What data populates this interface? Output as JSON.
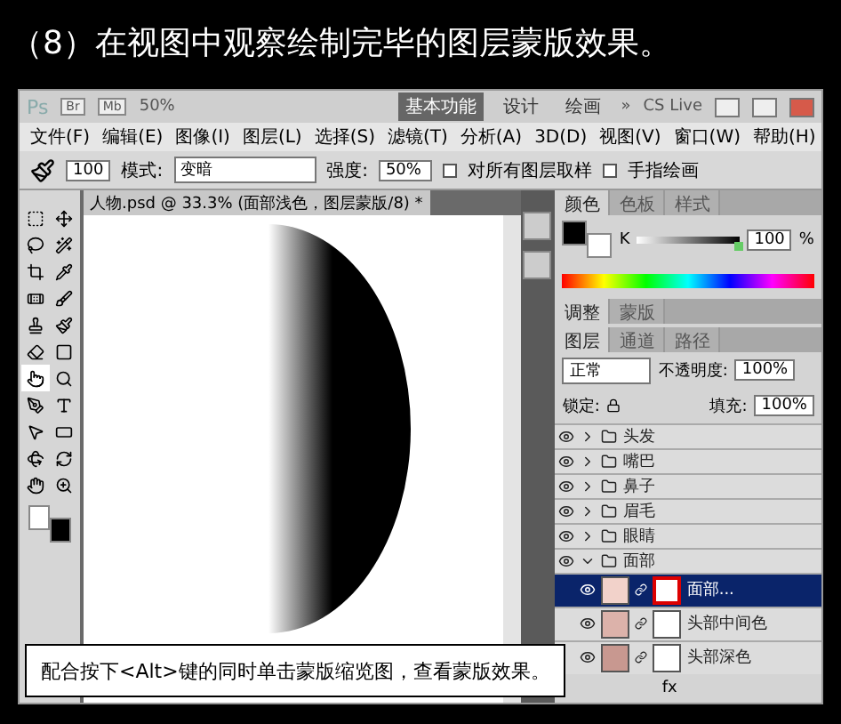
{
  "heading": "（8）在视图中观察绘制完毕的图层蒙版效果。",
  "app_bar": {
    "logo": "Ps",
    "bridge": "Br",
    "mini_bridge": "Mb",
    "zoom": "50%",
    "workspaces": [
      {
        "label": "基本功能",
        "selected": true
      },
      {
        "label": "设计",
        "selected": false
      },
      {
        "label": "绘画",
        "selected": false
      }
    ],
    "more": "»",
    "cs_live": "CS Live"
  },
  "menu": [
    "文件(F)",
    "编辑(E)",
    "图像(I)",
    "图层(L)",
    "选择(S)",
    "滤镜(T)",
    "分析(A)",
    "3D(D)",
    "视图(V)",
    "窗口(W)",
    "帮助(H)"
  ],
  "options": {
    "brush_size": "100",
    "mode_label": "模式:",
    "mode": "变暗",
    "strength_label": "强度:",
    "strength": "50%",
    "checks": [
      {
        "label": "对所有图层取样",
        "checked": false
      },
      {
        "label": "手指绘画",
        "checked": false
      }
    ]
  },
  "tools": [
    {
      "selected": false
    },
    {
      "selected": false
    },
    {
      "selected": false
    },
    {
      "selected": false
    },
    {
      "selected": false
    },
    {
      "selected": false
    },
    {
      "selected": false
    },
    {
      "selected": false
    },
    {
      "selected": false
    },
    {
      "selected": false
    },
    {
      "selected": false
    },
    {
      "selected": false
    },
    {
      "selected": true
    },
    {
      "selected": false
    },
    {
      "selected": false
    },
    {
      "selected": false
    },
    {
      "selected": false
    },
    {
      "selected": false
    },
    {
      "selected": false
    },
    {
      "selected": false
    },
    {
      "selected": false
    },
    {
      "selected": false
    }
  ],
  "document": {
    "tab": "人物.psd @ 33.3% (面部浅色，图层蒙版/8) *"
  },
  "color_panel": {
    "tabs": [
      {
        "label": "颜色",
        "selected": true
      },
      {
        "label": "色板",
        "selected": false
      },
      {
        "label": "样式",
        "selected": false
      }
    ],
    "channel": "K",
    "level": 1,
    "value": "100",
    "unit": "%"
  },
  "adjust_panel": {
    "tabs": [
      {
        "label": "调整",
        "selected": true
      },
      {
        "label": "蒙版",
        "selected": false
      }
    ]
  },
  "layers_panel": {
    "tabs": [
      {
        "label": "图层",
        "selected": true
      },
      {
        "label": "通道",
        "selected": false
      },
      {
        "label": "路径",
        "selected": false
      }
    ],
    "blend": "正常",
    "opacity_label": "不透明度:",
    "opacity": "100%",
    "lock_label": "锁定:",
    "fill_label": "填充:",
    "fill": "100%",
    "fx": "fx",
    "layers": [
      {
        "kind": "group",
        "name": "头发",
        "expanded": false,
        "selected": false
      },
      {
        "kind": "group",
        "name": "嘴巴",
        "expanded": false,
        "selected": false
      },
      {
        "kind": "group",
        "name": "鼻子",
        "expanded": false,
        "selected": false
      },
      {
        "kind": "group",
        "name": "眉毛",
        "expanded": false,
        "selected": false
      },
      {
        "kind": "group",
        "name": "眼睛",
        "expanded": false,
        "selected": false
      },
      {
        "kind": "group",
        "name": "面部",
        "expanded": true,
        "selected": false,
        "children": [
          {
            "kind": "layer",
            "name": "面部...",
            "color": "#f2d2ca",
            "selected": true,
            "highlighted": true
          },
          {
            "kind": "layer",
            "name": "头部中间色",
            "color": "#dcb2aa",
            "selected": false,
            "highlighted": false
          },
          {
            "kind": "layer",
            "name": "头部深色",
            "color": "#c89890",
            "selected": false,
            "highlighted": false
          }
        ]
      }
    ]
  },
  "caption": "配合按下<Alt>键的同时单击蒙版缩览图，查看蒙版效果。"
}
